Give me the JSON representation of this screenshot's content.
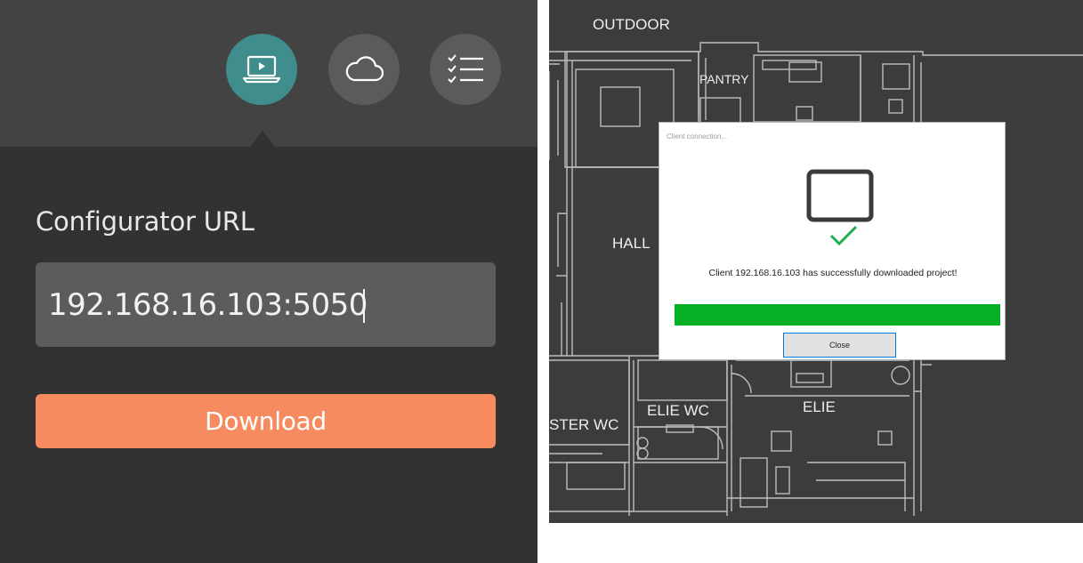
{
  "left": {
    "toolbar": {
      "buttons": [
        {
          "icon": "laptop-play-icon",
          "active": true
        },
        {
          "icon": "cloud-icon",
          "active": false
        },
        {
          "icon": "checklist-icon",
          "active": false
        }
      ]
    },
    "configurator": {
      "label": "Configurator URL",
      "url_value": "192.168.16.103:5050"
    },
    "download_label": "Download"
  },
  "right": {
    "floorplan": {
      "rooms": {
        "outdoor": "OUTDOOR",
        "pantry": "PANTRY",
        "hall": "HALL",
        "elie_wc": "ELIE WC",
        "elie": "ELIE",
        "ster_wc": "STER WC"
      }
    },
    "dialog": {
      "title": "Client connection...",
      "message": "Client  192.168.16.103  has successfully downloaded project!",
      "progress": 1.0,
      "close_label": "Close",
      "icon_monitor": "monitor-icon",
      "icon_check": "check-icon"
    }
  },
  "colors": {
    "accent_teal": "#3f8d8d",
    "download_orange": "#f58b5f",
    "progress_green": "#06b025",
    "check_green": "#1fae4b"
  }
}
